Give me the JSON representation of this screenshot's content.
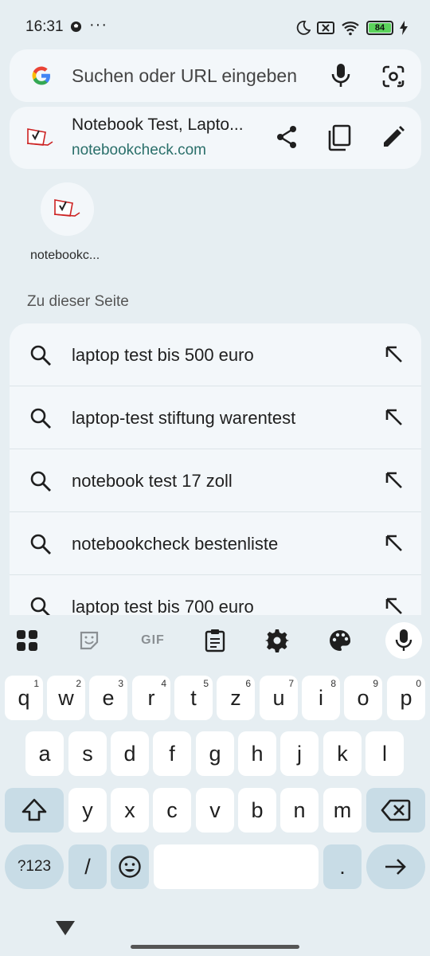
{
  "status": {
    "time": "16:31",
    "more": "···",
    "battery": "84"
  },
  "omnibox": {
    "placeholder": "Suchen oder URL eingeben"
  },
  "current_page": {
    "title": "Notebook Test, Lapto...",
    "url": "notebookcheck.com"
  },
  "shortcut": {
    "label": "notebookc..."
  },
  "section_title": "Zu dieser Seite",
  "suggestions": [
    "laptop test bis 500 euro",
    "laptop-test stiftung warentest",
    "notebook test 17 zoll",
    "notebookcheck bestenliste",
    "laptop test bis 700 euro"
  ],
  "keyboard": {
    "gif_label": "GIF",
    "row1": [
      "q",
      "w",
      "e",
      "r",
      "t",
      "z",
      "u",
      "i",
      "o",
      "p"
    ],
    "row1_hints": [
      "1",
      "2",
      "3",
      "4",
      "5",
      "6",
      "7",
      "8",
      "9",
      "0"
    ],
    "row2": [
      "a",
      "s",
      "d",
      "f",
      "g",
      "h",
      "j",
      "k",
      "l"
    ],
    "row3": [
      "y",
      "x",
      "c",
      "v",
      "b",
      "n",
      "m"
    ],
    "num_label": "?123",
    "slash": "/",
    "period": "."
  },
  "icons": [
    "google-logo",
    "mic-icon",
    "lens-icon",
    "share-icon",
    "copy-icon",
    "edit-icon",
    "search-icon",
    "arrow-up-left-icon",
    "apps-grid-icon",
    "sticker-icon",
    "clipboard-icon",
    "gear-icon",
    "palette-icon",
    "shift-icon",
    "backspace-icon",
    "emoji-icon",
    "enter-arrow-icon"
  ]
}
